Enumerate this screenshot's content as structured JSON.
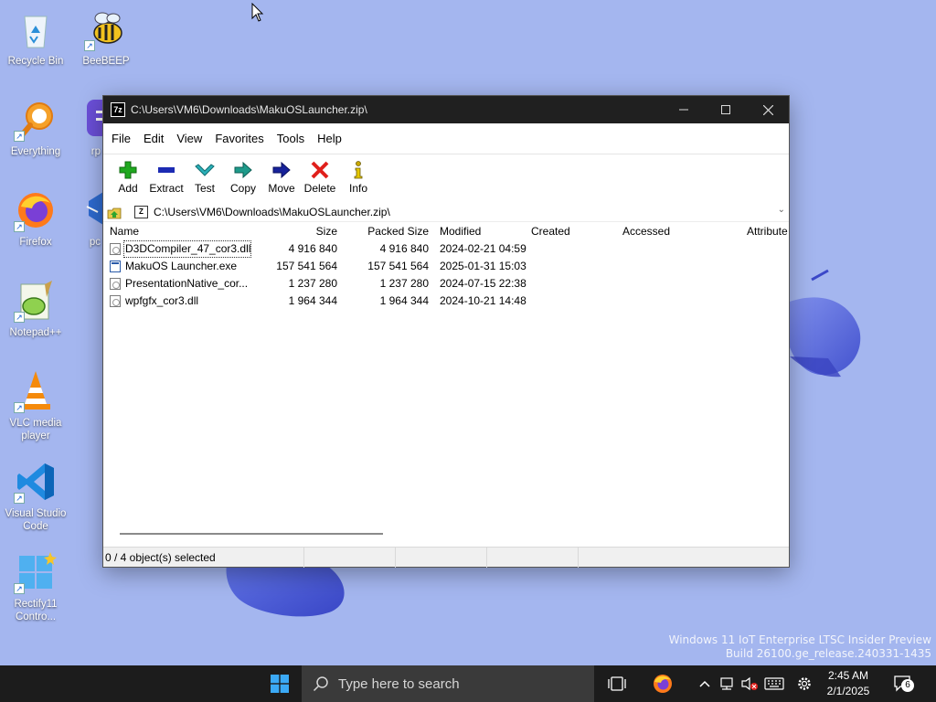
{
  "desktop": {
    "watermark_line1": "Windows 11 IoT Enterprise LTSC Insider Preview",
    "watermark_line2": "Build 26100.ge_release.240331-1435",
    "icons": [
      {
        "label": "Recycle Bin",
        "icon": "recycle-bin-icon"
      },
      {
        "label": "BeeBEEP",
        "icon": "beebeep-icon"
      },
      {
        "label": "Everything",
        "icon": "everything-search-icon"
      },
      {
        "label": "rp",
        "icon": "app-icon"
      },
      {
        "label": "Firefox",
        "icon": "firefox-icon"
      },
      {
        "label": "pc",
        "icon": "app-icon"
      },
      {
        "label": "Notepad++",
        "icon": "notepad-plus-plus-icon"
      },
      {
        "label": "VLC media player",
        "icon": "vlc-icon"
      },
      {
        "label": "Visual Studio Code",
        "icon": "vscode-icon"
      },
      {
        "label": "Rectify11 Contro...",
        "icon": "rectify11-icon"
      }
    ]
  },
  "window": {
    "title": "C:\\Users\\VM6\\Downloads\\MakuOSLauncher.zip\\",
    "app_icon_text": "7z",
    "menu": [
      "File",
      "Edit",
      "View",
      "Favorites",
      "Tools",
      "Help"
    ],
    "toolbar": [
      {
        "label": "Add",
        "icon": "add-icon"
      },
      {
        "label": "Extract",
        "icon": "extract-icon"
      },
      {
        "label": "Test",
        "icon": "test-icon"
      },
      {
        "label": "Copy",
        "icon": "copy-icon"
      },
      {
        "label": "Move",
        "icon": "move-icon"
      },
      {
        "label": "Delete",
        "icon": "delete-icon"
      },
      {
        "label": "Info",
        "icon": "info-icon"
      }
    ],
    "address": "C:\\Users\\VM6\\Downloads\\MakuOSLauncher.zip\\",
    "columns": [
      "Name",
      "Size",
      "Packed Size",
      "Modified",
      "Created",
      "Accessed",
      "Attribute"
    ],
    "files": [
      {
        "name": "D3DCompiler_47_cor3.dll",
        "size": "4 916 840",
        "packed": "4 916 840",
        "modified": "2024-02-21 04:59",
        "type": "dll"
      },
      {
        "name": "MakuOS Launcher.exe",
        "size": "157 541 564",
        "packed": "157 541 564",
        "modified": "2025-01-31 15:03",
        "type": "exe"
      },
      {
        "name": "PresentationNative_cor...",
        "size": "1 237 280",
        "packed": "1 237 280",
        "modified": "2024-07-15 22:38",
        "type": "dll"
      },
      {
        "name": "wpfgfx_cor3.dll",
        "size": "1 964 344",
        "packed": "1 964 344",
        "modified": "2024-10-21 14:48",
        "type": "dll"
      }
    ],
    "status": "0 / 4 object(s) selected"
  },
  "taskbar": {
    "search_placeholder": "Type here to search",
    "time": "2:45 AM",
    "date": "2/1/2025",
    "notification_count": "6"
  },
  "colors": {
    "wallpaper": "#a4b6ef",
    "bloom": "#4a5fd4",
    "titlebar": "#202020",
    "taskbar": "#1c1c1c",
    "delete_red": "#e0201c",
    "add_green": "#1fa81f"
  }
}
